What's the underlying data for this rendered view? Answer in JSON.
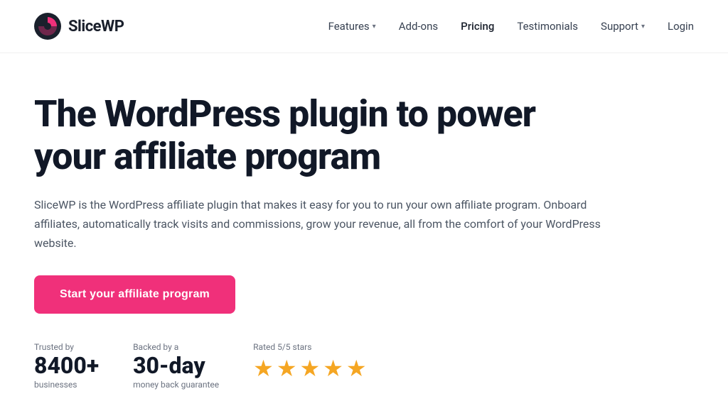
{
  "header": {
    "logo_text": "SliceWP",
    "nav": {
      "features_label": "Features",
      "addons_label": "Add-ons",
      "pricing_label": "Pricing",
      "testimonials_label": "Testimonials",
      "support_label": "Support",
      "login_label": "Login"
    }
  },
  "hero": {
    "title_line1": "The WordPress plugin to power",
    "title_line2": "your affiliate program",
    "description": "SliceWP is the WordPress affiliate plugin that makes it easy for you to run your own affiliate program. Onboard affiliates, automatically track visits and commissions, grow your revenue, all from the comfort of your WordPress website.",
    "cta_label": "Start your affiliate program"
  },
  "trust": {
    "trusted_label": "Trusted by",
    "trusted_value": "8400+",
    "trusted_sub": "businesses",
    "backed_label": "Backed by a",
    "backed_value": "30-day",
    "backed_sub": "money back guarantee",
    "rated_label": "Rated 5/5 stars",
    "star_count": 5,
    "star_symbol": "★"
  },
  "colors": {
    "cta_bg": "#f0307a",
    "logo_accent": "#f0307a",
    "star_color": "#f5a623",
    "nav_text": "#374151",
    "heading_color": "#111827",
    "body_text": "#4b5563"
  }
}
